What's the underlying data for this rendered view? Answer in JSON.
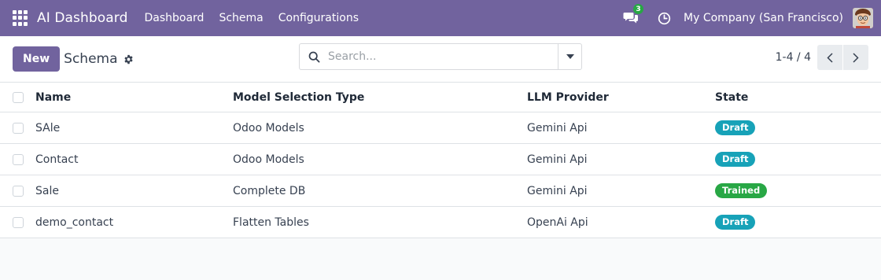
{
  "navbar": {
    "brand": "AI Dashboard",
    "links": [
      "Dashboard",
      "Schema",
      "Configurations"
    ],
    "chat_count": "3",
    "company": "My Company (San Francisco)",
    "colors": {
      "primary": "#71639e"
    }
  },
  "control_panel": {
    "new_label": "New",
    "title": "Schema",
    "search_placeholder": "Search...",
    "pager": "1-4 / 4"
  },
  "table": {
    "columns": [
      "Name",
      "Model Selection Type",
      "LLM Provider",
      "State"
    ],
    "rows": [
      {
        "name": "SAle",
        "type": "Odoo Models",
        "llm": "Gemini Api",
        "state": "Draft",
        "state_color": "#17a2b8"
      },
      {
        "name": "Contact",
        "type": "Odoo Models",
        "llm": "Gemini Api",
        "state": "Draft",
        "state_color": "#17a2b8"
      },
      {
        "name": "Sale",
        "type": "Complete DB",
        "llm": "Gemini Api",
        "state": "Trained",
        "state_color": "#28a745"
      },
      {
        "name": "demo_contact",
        "type": "Flatten Tables",
        "llm": "OpenAi Api",
        "state": "Draft",
        "state_color": "#17a2b8"
      }
    ]
  }
}
